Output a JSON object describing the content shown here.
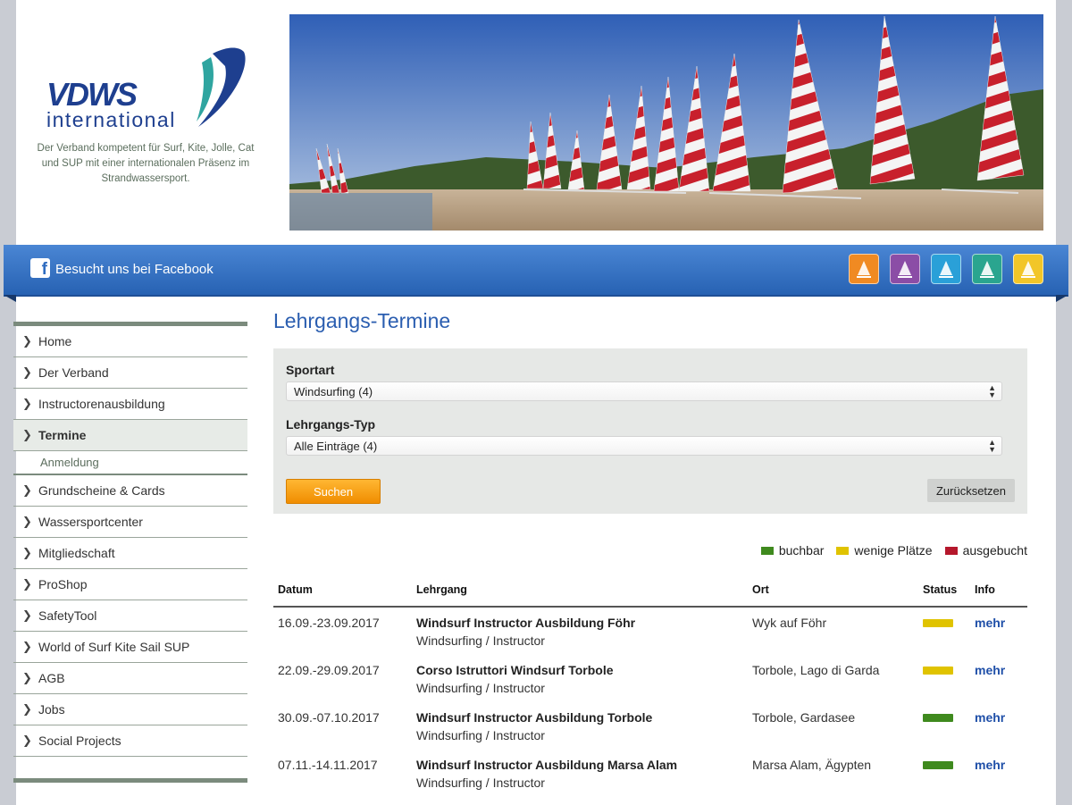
{
  "header": {
    "logo_word": "VDWS",
    "logo_sub": "international",
    "tagline": "Der Verband kompetent für Surf, Kite, Jolle, Cat und SUP mit einer internationalen Präsenz im Strandwassersport."
  },
  "facebook_bar": {
    "text": "Besucht uns bei Facebook",
    "sport_icons": [
      {
        "name": "windsurf-icon",
        "color": "#f08a22"
      },
      {
        "name": "kitesurf-icon",
        "color": "#8b4da6"
      },
      {
        "name": "sailing-dinghy-icon",
        "color": "#2aa0d8"
      },
      {
        "name": "catamaran-icon",
        "color": "#2aa58f"
      },
      {
        "name": "sup-icon",
        "color": "#f2c628"
      }
    ]
  },
  "sidebar": {
    "items": [
      {
        "label": "Home"
      },
      {
        "label": "Der Verband"
      },
      {
        "label": "Instructorenausbildung"
      },
      {
        "label": "Termine",
        "active": true
      },
      {
        "label": "Anmeldung",
        "sub": true
      },
      {
        "label": "Grundscheine & Cards"
      },
      {
        "label": "Wassersportcenter"
      },
      {
        "label": "Mitgliedschaft"
      },
      {
        "label": "ProShop"
      },
      {
        "label": "SafetyTool"
      },
      {
        "label": "World of Surf Kite Sail SUP"
      },
      {
        "label": "AGB"
      },
      {
        "label": "Jobs"
      },
      {
        "label": "Social Projects"
      }
    ]
  },
  "main": {
    "title": "Lehrgangs-Termine",
    "filter": {
      "sport_label": "Sportart",
      "sport_value": "Windsurfing (4)",
      "type_label": "Lehrgangs-Typ",
      "type_value": "Alle Einträge (4)",
      "search_button": "Suchen",
      "reset_button": "Zurücksetzen"
    },
    "legend": [
      {
        "label": "buchbar",
        "color": "#3f8a1e"
      },
      {
        "label": "wenige Plätze",
        "color": "#e0c300"
      },
      {
        "label": "ausgebucht",
        "color": "#b5172c"
      }
    ],
    "table": {
      "headers": [
        "Datum",
        "Lehrgang",
        "Ort",
        "Status",
        "Info"
      ],
      "rows": [
        {
          "date": "16.09.-23.09.2017",
          "title": "Windsurf Instructor Ausbildung Föhr",
          "subtitle": "Windsurfing / Instructor",
          "place": "Wyk auf Föhr",
          "status_color": "#e0c300",
          "info": "mehr"
        },
        {
          "date": "22.09.-29.09.2017",
          "title": "Corso Istruttori Windsurf Torbole",
          "subtitle": "Windsurfing / Instructor",
          "place": "Torbole, Lago di Garda",
          "status_color": "#e0c300",
          "info": "mehr"
        },
        {
          "date": "30.09.-07.10.2017",
          "title": "Windsurf Instructor Ausbildung Torbole",
          "subtitle": "Windsurfing / Instructor",
          "place": "Torbole, Gardasee",
          "status_color": "#3f8a1e",
          "info": "mehr"
        },
        {
          "date": "07.11.-14.11.2017",
          "title": "Windsurf Instructor Ausbildung Marsa Alam",
          "subtitle": "Windsurfing / Instructor",
          "place": "Marsa Alam, Ägypten",
          "status_color": "#3f8a1e",
          "info": "mehr"
        }
      ]
    }
  }
}
